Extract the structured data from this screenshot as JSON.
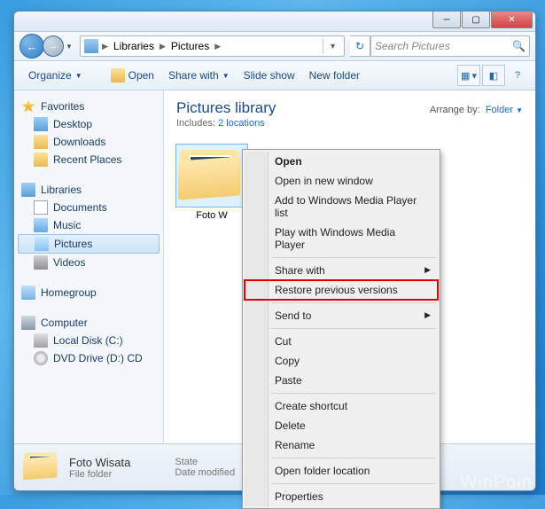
{
  "breadcrumb": {
    "root": "Libraries",
    "leaf": "Pictures"
  },
  "search": {
    "placeholder": "Search Pictures"
  },
  "toolbar": {
    "organize": "Organize",
    "open": "Open",
    "share": "Share with",
    "slideshow": "Slide show",
    "newfolder": "New folder"
  },
  "sidebar": {
    "favorites": "Favorites",
    "fav_items": [
      "Desktop",
      "Downloads",
      "Recent Places"
    ],
    "libraries": "Libraries",
    "lib_items": [
      "Documents",
      "Music",
      "Pictures",
      "Videos"
    ],
    "homegroup": "Homegroup",
    "computer": "Computer",
    "comp_items": [
      "Local Disk (C:)",
      "DVD Drive (D:) CD"
    ]
  },
  "content": {
    "title": "Pictures library",
    "includes_label": "Includes:",
    "includes_link": "2 locations",
    "arrange_label": "Arrange by:",
    "arrange_value": "Folder",
    "items": [
      {
        "label": "Foto W"
      }
    ]
  },
  "statusbar": {
    "name": "Foto Wisata",
    "type": "File folder",
    "state_label": "State",
    "date_label": "Date modified"
  },
  "context_menu": {
    "open": "Open",
    "open_new": "Open in new window",
    "wmp_list": "Add to Windows Media Player list",
    "wmp_play": "Play with Windows Media Player",
    "share": "Share with",
    "restore": "Restore previous versions",
    "sendto": "Send to",
    "cut": "Cut",
    "copy": "Copy",
    "paste": "Paste",
    "shortcut": "Create shortcut",
    "delete": "Delete",
    "rename": "Rename",
    "open_loc": "Open folder location",
    "props": "Properties"
  },
  "watermark": "WinPoin"
}
